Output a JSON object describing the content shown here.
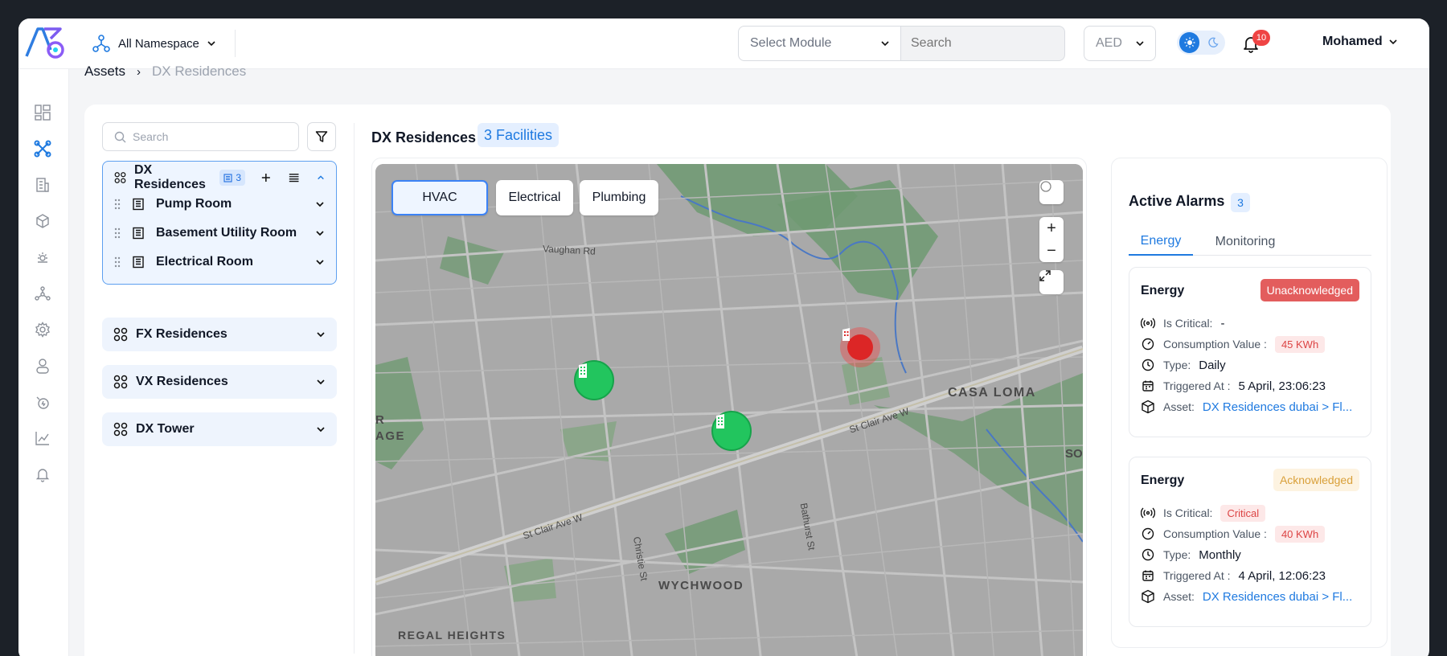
{
  "topbar": {
    "namespace": "All Namespace",
    "module_placeholder": "Select Module",
    "search_placeholder": "Search",
    "currency": "AED",
    "notification_count": "10",
    "user_name": "Mohamed"
  },
  "breadcrumb": {
    "root": "Assets",
    "current": "DX Residences"
  },
  "tree": {
    "search_placeholder": "Search",
    "open_group": {
      "name": "DX Residences",
      "count": "3"
    },
    "children": [
      {
        "name": "Pump Room"
      },
      {
        "name": "Basement Utility Room"
      },
      {
        "name": "Electrical Room"
      }
    ],
    "groups": [
      {
        "name": "FX Residences"
      },
      {
        "name": "VX Residences"
      },
      {
        "name": "DX Tower"
      }
    ]
  },
  "content": {
    "title": "DX Residences",
    "facilities": "3 Facilities"
  },
  "map": {
    "tabs": [
      {
        "label": "HVAC"
      },
      {
        "label": "Electrical"
      },
      {
        "label": "Plumbing"
      }
    ],
    "labels": {
      "vaughan": "Vaughan Rd",
      "casa_loma": "CASA LOMA",
      "st_clair_1": "St Clair Ave W",
      "st_clair_2": "St Clair Ave W",
      "christie": "Christie St",
      "bathurst": "Bathurst St",
      "wychwood": "WYCHWOOD",
      "regal": "REGAL HEIGHTS",
      "age": "AGE",
      "r": "R",
      "so": "SO"
    }
  },
  "alarms": {
    "title": "Active Alarms",
    "count": "3",
    "tabs": {
      "energy": "Energy",
      "monitoring": "Monitoring"
    },
    "labels": {
      "critical": "Is Critical:",
      "consumption": "Consumption Value :",
      "type": "Type:",
      "triggered": "Triggered At :",
      "asset": "Asset:"
    },
    "cards": [
      {
        "title": "Energy",
        "status": "Unacknowledged",
        "critical": "-",
        "consumption": "45 KWh",
        "type": "Daily",
        "triggered": "5 April, 23:06:23",
        "asset": "DX Residences dubai > Fl..."
      },
      {
        "title": "Energy",
        "status": "Acknowledged",
        "critical": "Critical",
        "consumption": "40 KWh",
        "type": "Monthly",
        "triggered": "4 April, 12:06:23",
        "asset": "DX Residences  dubai > Fl..."
      }
    ]
  },
  "colors": {
    "accent": "#1f7ae0",
    "danger": "#ef4444",
    "success": "#22c55e",
    "warning": "#d9a03a"
  }
}
